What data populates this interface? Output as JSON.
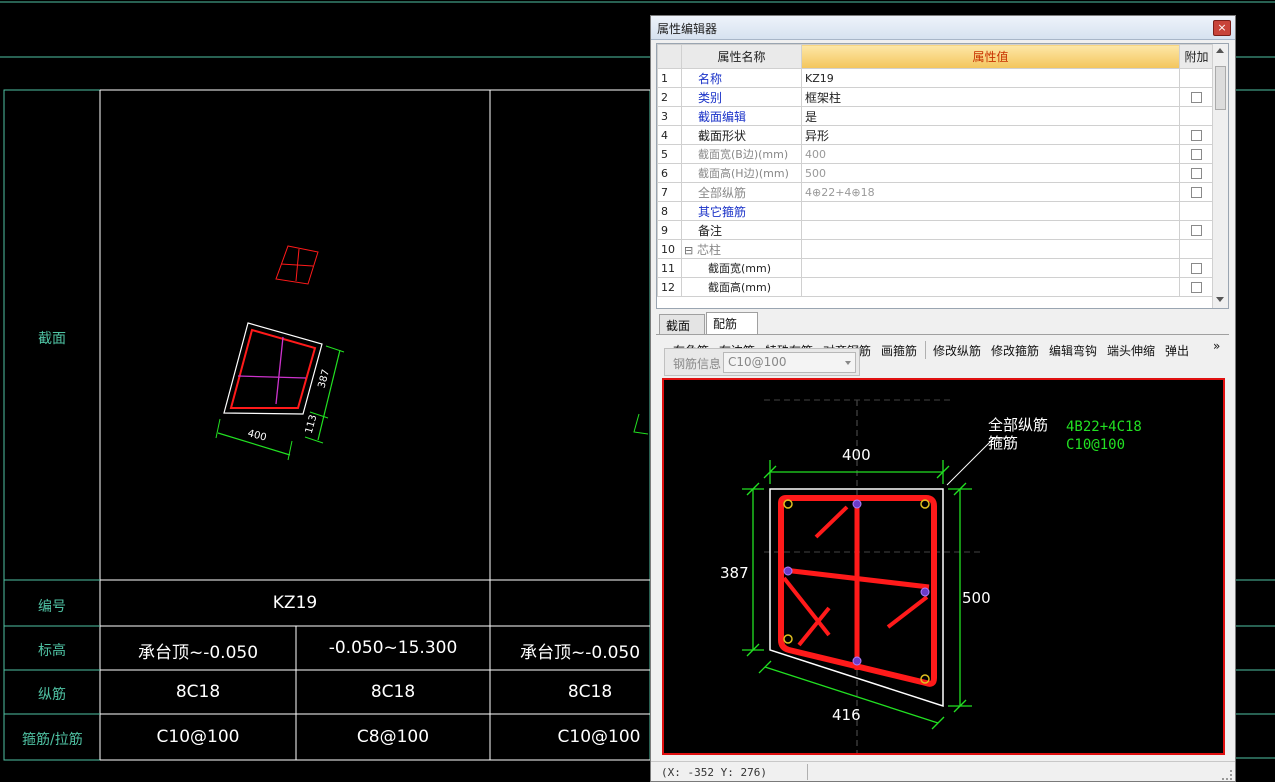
{
  "cad": {
    "row_labels": {
      "section": "截面",
      "code": "编号",
      "elevation": "标高",
      "longitudinal": "纵筋",
      "stirrup": "箍筋/拉筋"
    },
    "code_value": "KZ19",
    "elevations": [
      "承台顶~-0.050",
      "-0.050~15.300",
      "承台顶~-0.050"
    ],
    "longitudinal_values": [
      "8C18",
      "8C18",
      "8C18"
    ],
    "stirrup_values": [
      "C10@100",
      "C8@100",
      "C10@100"
    ],
    "dim_width": "400",
    "dim_387": "387",
    "dim_113": "113"
  },
  "editor": {
    "title": "属性编辑器",
    "close_symbol": "×",
    "headers": {
      "name": "属性名称",
      "value": "属性值",
      "extra": "附加"
    },
    "rows": [
      {
        "num": "1",
        "name": "名称",
        "value": "KZ19"
      },
      {
        "num": "2",
        "name": "类别",
        "value": "框架柱"
      },
      {
        "num": "3",
        "name": "截面编辑",
        "value": "是"
      },
      {
        "num": "4",
        "name": "截面形状",
        "value": "异形"
      },
      {
        "num": "5",
        "name": "截面宽(B边)(mm)",
        "value": "400"
      },
      {
        "num": "6",
        "name": "截面高(H边)(mm)",
        "value": "500"
      },
      {
        "num": "7",
        "name": "全部纵筋",
        "value": "4⊕22+4⊕18"
      },
      {
        "num": "8",
        "name": "其它箍筋",
        "value": ""
      },
      {
        "num": "9",
        "name": "备注",
        "value": ""
      },
      {
        "num": "10",
        "name": "芯柱",
        "value": "",
        "toggle": "⊟"
      },
      {
        "num": "11",
        "name": "截面宽(mm)",
        "value": ""
      },
      {
        "num": "12",
        "name": "截面高(mm)",
        "value": ""
      }
    ],
    "tabs": [
      "截面",
      "配筋"
    ],
    "toolbar": [
      "布角筋",
      "布边筋",
      "特殊布筋",
      "对齐钢筋",
      "画箍筋",
      "修改纵筋",
      "修改箍筋",
      "编辑弯钩",
      "端头伸缩",
      "弹出"
    ],
    "toolbar_more": "»",
    "rebar_info_label": "钢筋信息",
    "rebar_info_value": "C10@100",
    "preview": {
      "label_all_long": "全部纵筋",
      "label_stirrup": "箍筋",
      "value_all_long": "4B22+4C18",
      "value_stirrup": "C10@100",
      "dim_top": "400",
      "dim_left": "387",
      "dim_right": "500",
      "dim_bottom": "416"
    },
    "status": "(X: -352 Y: 276)"
  },
  "colors": {
    "cad_line": "#4fc2a3",
    "rebar_red": "#ff1a1a",
    "dim_green": "#22e022",
    "header_value_bg": "#f3c55c"
  }
}
